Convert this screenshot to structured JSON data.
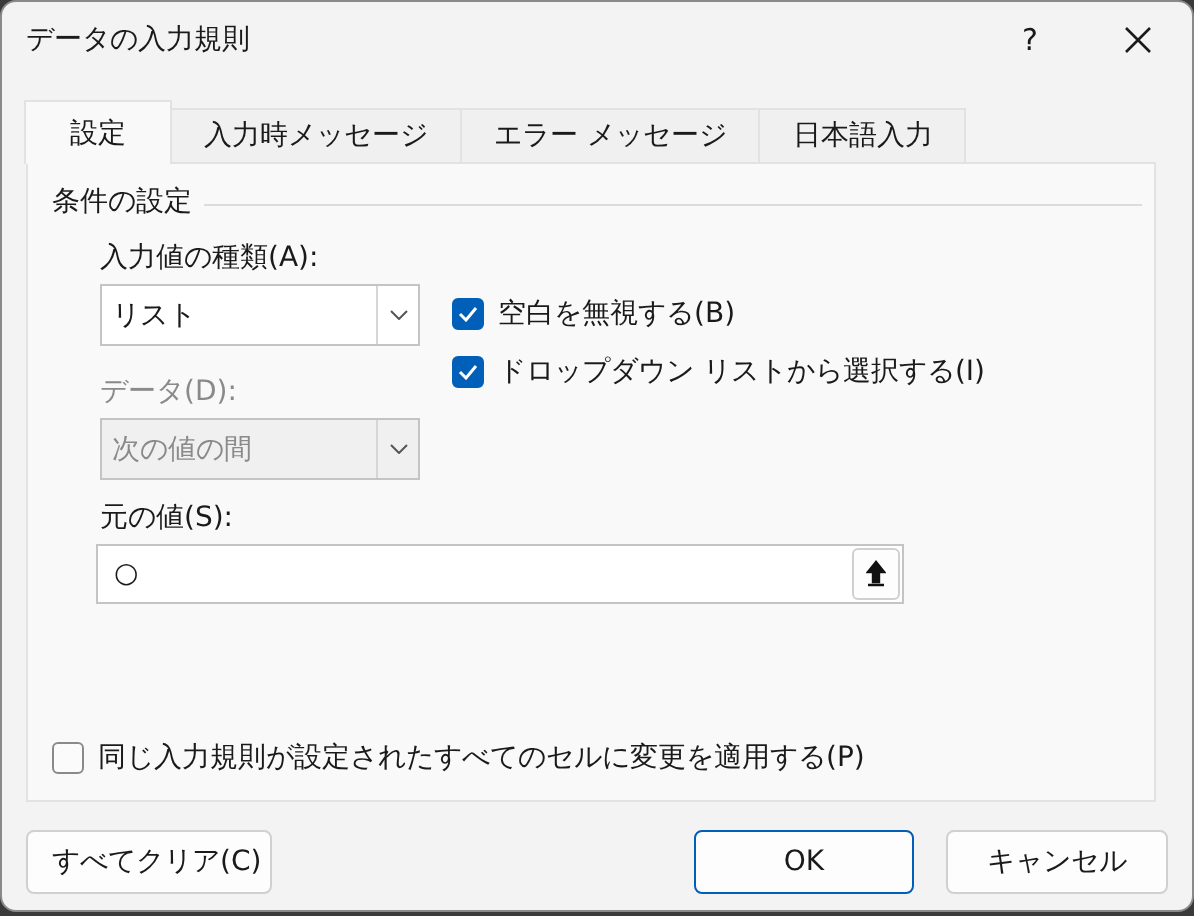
{
  "window": {
    "title": "データの入力規則",
    "help_button": "?"
  },
  "tabs": [
    {
      "label": "設定",
      "selected": true
    },
    {
      "label": "入力時メッセージ",
      "selected": false
    },
    {
      "label": "エラー メッセージ",
      "selected": false
    },
    {
      "label": "日本語入力",
      "selected": false
    }
  ],
  "group": {
    "title": "条件の設定"
  },
  "allow": {
    "label": "入力値の種類(A):",
    "value": "リスト",
    "disabled": false
  },
  "data": {
    "label": "データ(D):",
    "value": "次の値の間",
    "disabled": true
  },
  "checkboxes": [
    {
      "label": "空白を無視する(B)",
      "checked": true
    },
    {
      "label": "ドロップダウン リストから選択する(I)",
      "checked": true
    }
  ],
  "source": {
    "label": "元の値(S):",
    "value": "○"
  },
  "apply_all": {
    "label": "同じ入力規則が設定されたすべてのセルに変更を適用する(P)",
    "checked": false
  },
  "buttons": [
    {
      "label": "すべてクリア(C)",
      "kind": "normal"
    },
    {
      "label": "OK",
      "kind": "default"
    },
    {
      "label": "キャンセル",
      "kind": "normal"
    }
  ]
}
